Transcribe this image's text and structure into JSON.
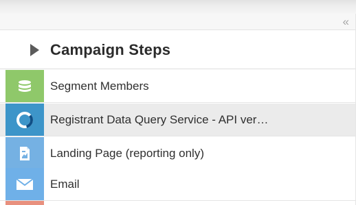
{
  "panel": {
    "collapse_icon": "double-chevron-left-icon",
    "collapse_glyph": "«"
  },
  "header": {
    "title": "Campaign Steps",
    "toggle_icon": "triangle-right-icon"
  },
  "steps": [
    {
      "label": "Segment Members",
      "icon": "database-icon",
      "color": "#8fc86a"
    },
    {
      "label": "Registrant Data Query Service - API ver…",
      "icon": "swirl-logo-icon",
      "color": "#3d95c9"
    },
    {
      "label": "Landing Page (reporting only)",
      "icon": "page-icon",
      "color": "#75b1e3"
    },
    {
      "label": "Email",
      "icon": "envelope-icon",
      "color": "#6fb0e8"
    }
  ],
  "partial_step": {
    "color": "#e8907e"
  }
}
